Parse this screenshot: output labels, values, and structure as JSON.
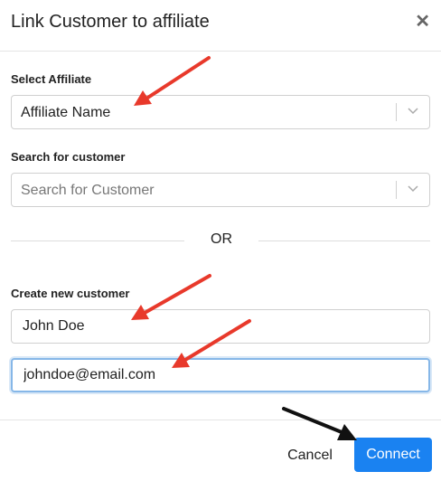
{
  "dialog": {
    "title": "Link Customer to affiliate",
    "close_icon": "close-icon"
  },
  "affiliate": {
    "label": "Select Affiliate",
    "selected": "Affiliate Name"
  },
  "customer_search": {
    "label": "Search for customer",
    "placeholder": "Search for Customer"
  },
  "divider": {
    "text": "OR"
  },
  "new_customer": {
    "label": "Create new customer",
    "name_value": "John Doe",
    "email_value": "johndoe@email.com"
  },
  "footer": {
    "cancel_label": "Cancel",
    "connect_label": "Connect"
  },
  "colors": {
    "primary": "#1a82f1",
    "annotation_red": "#e8392b",
    "annotation_black": "#111111",
    "focus_border": "#86b7e8"
  }
}
